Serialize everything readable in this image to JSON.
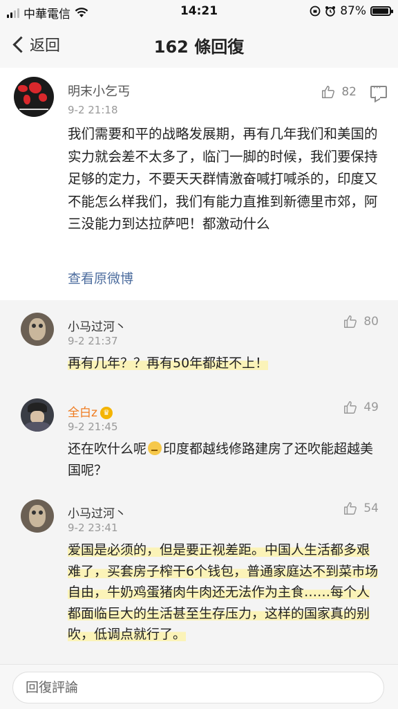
{
  "status_bar": {
    "carrier": "中華電信",
    "time": "14:21",
    "battery": "87%",
    "battery_level": 0.87
  },
  "nav": {
    "back_label": "返回",
    "title": "162 條回復"
  },
  "post": {
    "author": "明末小乞丐",
    "time": "9-2 21:18",
    "likes": "82",
    "text": "我们需要和平的战略发展期，再有几年我们和美国的实力就会差不太多了，临门一脚的时候，我们要保持足够的定力，不要天天群情激奋喊打喊杀的，印度又不能怎么样我们，我们有能力直推到新德里市郊，阿三没能力到达拉萨吧！都激动什么",
    "view_original": "查看原微博"
  },
  "replies": [
    {
      "author": "小马过河丶",
      "time": "9-2 21:37",
      "likes": "80",
      "text": "再有几年？？再有50年都赶不上！"
    },
    {
      "author": "全白z",
      "time": "9-2 21:45",
      "likes": "49",
      "text_a": "还在吹什么呢",
      "text_b": "印度都越线修路建房了还吹能超越美国呢？"
    },
    {
      "author": "小马过河丶",
      "time": "9-2 23:41",
      "likes": "54",
      "text": "爱国是必须的，但是要正视差距。中国人生活都多艰难了，买套房子榨干6个钱包，普通家庭达不到菜市场自由，牛奶鸡蛋猪肉牛肉还无法作为主食……每个人都面临巨大的生活甚至生存压力，这样的国家真的别吹，低调点就行了。"
    }
  ],
  "comment_bar": {
    "placeholder": "回復評論"
  },
  "colors": {
    "link": "#4e6e9f",
    "vip_name": "#ef7b1f",
    "highlight": "#fbf3b8"
  }
}
